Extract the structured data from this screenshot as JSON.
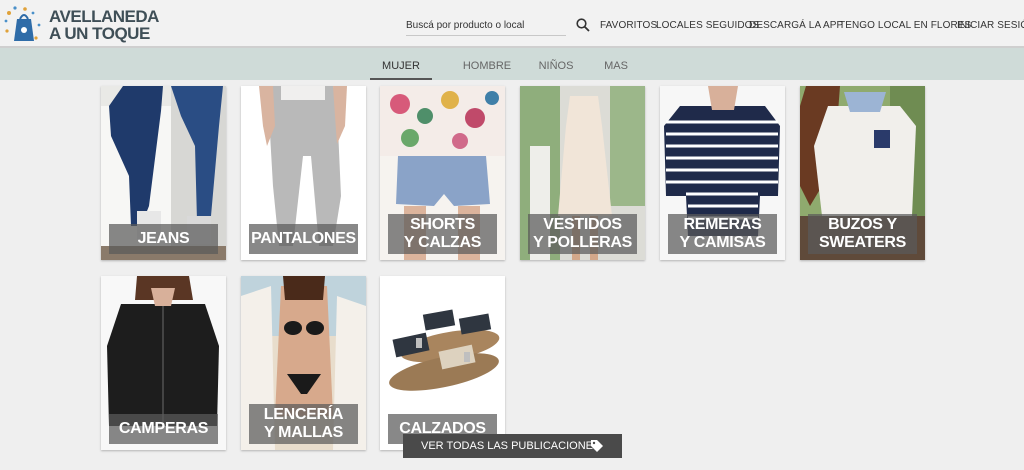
{
  "brand": {
    "line1": "AVELLANEDA",
    "line2": "A UN TOQUE",
    "logo_icon": "shopping-bag-icon"
  },
  "search": {
    "placeholder": "Buscá por producto o local",
    "icon": "search-icon"
  },
  "nav": {
    "favorites": "FAVORITOS",
    "followed": "LOCALES SEGUIDOS",
    "download": "DESCARGÁ LA APP",
    "have_store": "TENGO LOCAL EN FLORES",
    "login": "INICIAR SESIÓN"
  },
  "tabs": [
    {
      "label": "MUJER",
      "active": true
    },
    {
      "label": "HOMBRE",
      "active": false
    },
    {
      "label": "NIÑOS",
      "active": false
    },
    {
      "label": "MAS",
      "active": false
    }
  ],
  "categories": [
    {
      "label": "JEANS"
    },
    {
      "label": "PANTALONES"
    },
    {
      "label": "SHORTS\nY CALZAS"
    },
    {
      "label": "VESTIDOS\nY POLLERAS"
    },
    {
      "label": "REMERAS\nY CAMISAS"
    },
    {
      "label": "BUZOS Y\nSWEATERS"
    },
    {
      "label": "CAMPERAS"
    },
    {
      "label": "LENCERÍA\nY MALLAS"
    },
    {
      "label": "CALZADOS"
    }
  ],
  "see_all": {
    "label": "VER TODAS LAS PUBLICACIONES",
    "icon": "tag-icon"
  },
  "colors": {
    "header_bg": "#f2f2f2",
    "tabs_bg": "#cfdbd8",
    "page_bg": "#efefef",
    "label_overlay": "#5a5a5a",
    "button_bg": "#4a4a4a"
  }
}
